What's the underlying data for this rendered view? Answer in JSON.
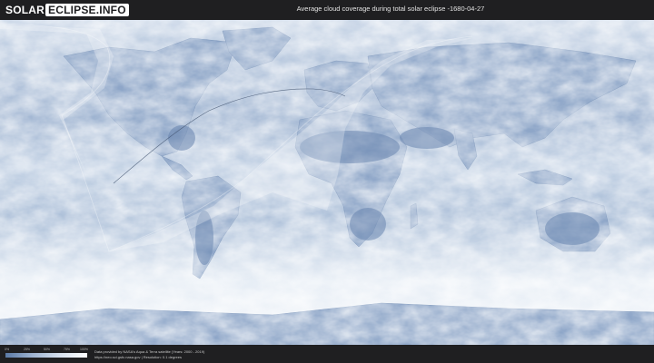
{
  "header": {
    "logo_left": "SOLAR",
    "logo_right": "ECLIPSE.INFO",
    "title": "Average cloud coverage during total solar eclipse -1680-04-27"
  },
  "legend": {
    "ticks": [
      "0%",
      "25%",
      "50%",
      "75%",
      "100%"
    ],
    "gradient_colors": [
      "#5b7aa6",
      "#9fb4d1",
      "#d7e1ee",
      "#ffffff"
    ]
  },
  "footer": {
    "credit_line1": "Data provided by NASA's Aqua & Terra satellite (Years: 2000 - 2019)",
    "credit_line2": "https://neo.sci.gsfc.nasa.gov | Resolution: 0.1 degrees"
  },
  "colors": {
    "clear_sky": "#5b7aa6",
    "cloudy": "#ffffff",
    "background": "#1f1f21"
  }
}
